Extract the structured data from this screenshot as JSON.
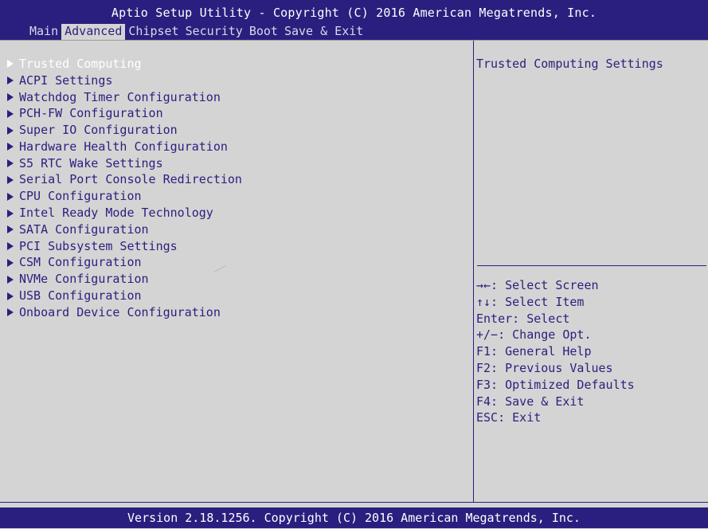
{
  "header": {
    "title": "Aptio Setup Utility - Copyright (C) 2016 American Megatrends, Inc.",
    "tabs": [
      {
        "label": "Main"
      },
      {
        "label": "Advanced"
      },
      {
        "label": "Chipset"
      },
      {
        "label": "Security"
      },
      {
        "label": "Boot"
      },
      {
        "label": "Save & Exit"
      }
    ],
    "active_tab": "Advanced"
  },
  "menu": {
    "selected": "Trusted Computing",
    "items": [
      {
        "label": "Trusted Computing"
      },
      {
        "label": "ACPI Settings"
      },
      {
        "label": "Watchdog Timer Configuration"
      },
      {
        "label": "PCH-FW Configuration"
      },
      {
        "label": "Super IO Configuration"
      },
      {
        "label": "Hardware Health Configuration"
      },
      {
        "label": "S5 RTC Wake Settings"
      },
      {
        "label": "Serial Port Console Redirection"
      },
      {
        "label": "CPU Configuration"
      },
      {
        "label": "Intel Ready Mode Technology"
      },
      {
        "label": "SATA Configuration"
      },
      {
        "label": "PCI Subsystem Settings"
      },
      {
        "label": "CSM Configuration"
      },
      {
        "label": "NVMe Configuration"
      },
      {
        "label": "USB Configuration"
      },
      {
        "label": "Onboard Device Configuration"
      }
    ]
  },
  "help": {
    "description": "Trusted Computing Settings",
    "keys": [
      "→←: Select Screen",
      "↑↓: Select Item",
      "Enter: Select",
      "+/−: Change Opt.",
      "F1: General Help",
      "F2: Previous Values",
      "F3: Optimized Defaults",
      "F4: Save & Exit",
      "ESC: Exit"
    ]
  },
  "footer": {
    "text": "Version 2.18.1256. Copyright (C) 2016 American Megatrends, Inc."
  },
  "colors": {
    "bar": "#2a1f7e",
    "background": "#d4d4d4",
    "text": "#2a1f7e",
    "highlight_text": "#ffffff"
  }
}
